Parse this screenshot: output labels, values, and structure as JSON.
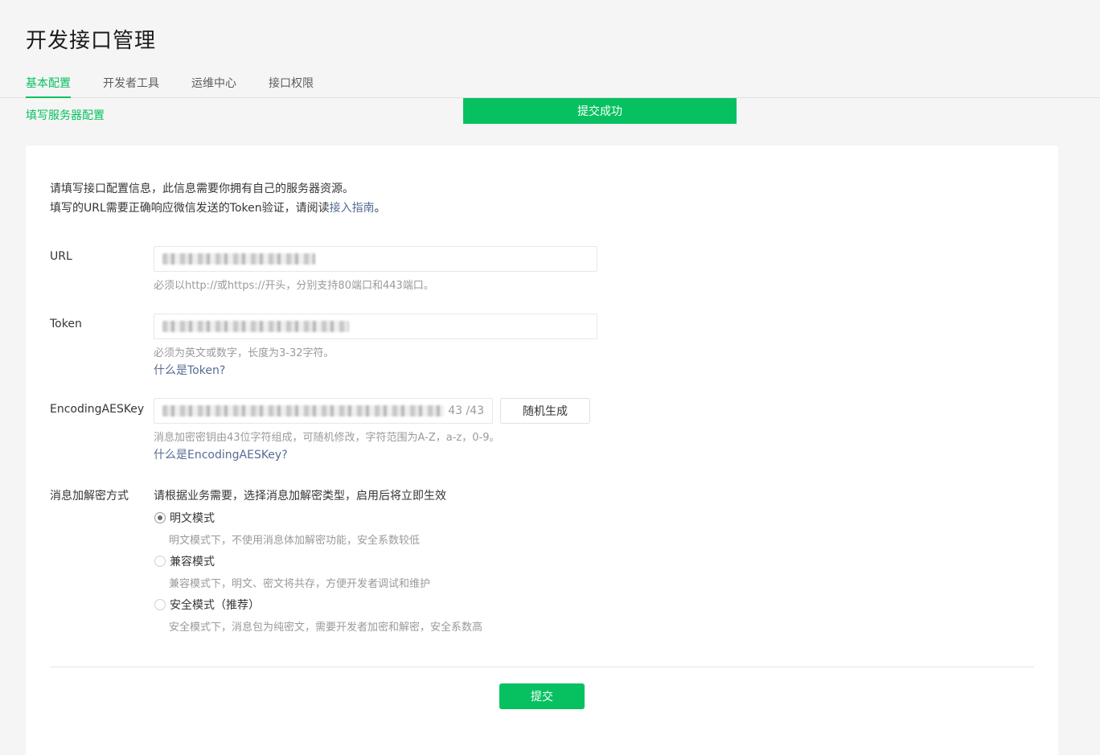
{
  "page_title": "开发接口管理",
  "tabs": [
    {
      "label": "基本配置",
      "active": true
    },
    {
      "label": "开发者工具",
      "active": false
    },
    {
      "label": "运维中心",
      "active": false
    },
    {
      "label": "接口权限",
      "active": false
    }
  ],
  "subnav": {
    "label": "填写服务器配置"
  },
  "toast": {
    "message": "提交成功"
  },
  "intro": {
    "line1": "请填写接口配置信息，此信息需要你拥有自己的服务器资源。",
    "line2_prefix": "填写的URL需要正确响应微信发送的Token验证，请阅读",
    "line2_link": "接入指南",
    "line2_suffix": "。"
  },
  "url_field": {
    "label": "URL",
    "tip": "必须以http://或https://开头，分别支持80端口和443端口。"
  },
  "token_field": {
    "label": "Token",
    "tip": "必须为英文或数字，长度为3-32字符。",
    "help_link": "什么是Token?"
  },
  "aes_field": {
    "label": "EncodingAESKey",
    "counter": "43 /43",
    "random_button": "随机生成",
    "tip": "消息加密密钥由43位字符组成，可随机修改，字符范围为A-Z，a-z，0-9。",
    "help_link": "什么是EncodingAESKey?"
  },
  "encryption": {
    "label": "消息加解密方式",
    "description": "请根据业务需要，选择消息加解密类型，启用后将立即生效",
    "options": [
      {
        "label": "明文模式",
        "desc": "明文模式下，不使用消息体加解密功能，安全系数较低",
        "checked": true
      },
      {
        "label": "兼容模式",
        "desc": "兼容模式下，明文、密文将共存，方便开发者调试和维护",
        "checked": false
      },
      {
        "label": "安全模式（推荐）",
        "desc": "安全模式下，消息包为纯密文，需要开发者加密和解密，安全系数高",
        "checked": false
      }
    ]
  },
  "submit_button": "提交",
  "colors": {
    "accent": "#07c160",
    "link": "#576b95"
  }
}
